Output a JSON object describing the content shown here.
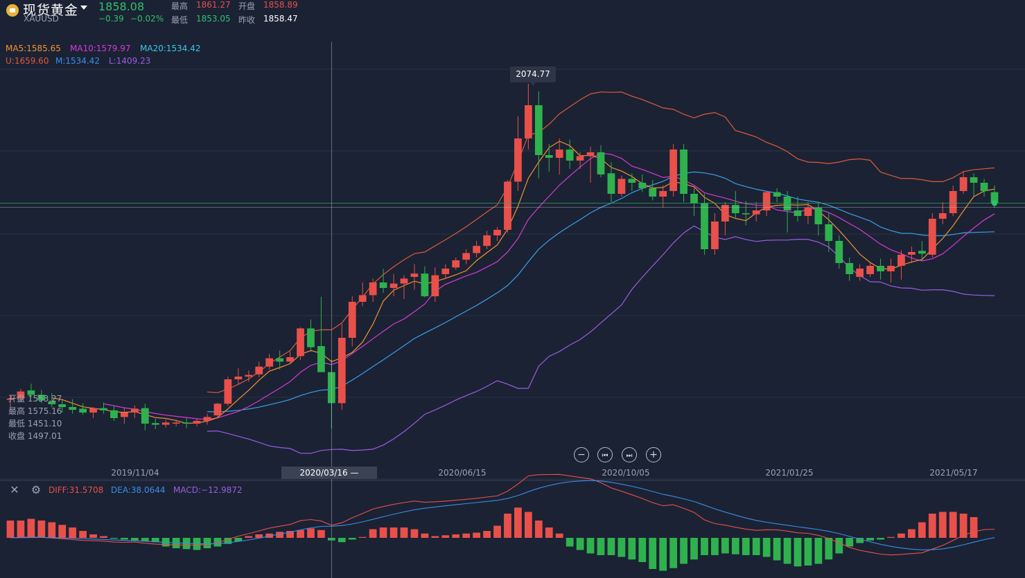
{
  "header": {
    "title": "现货黄金",
    "symbol": "XAUUSD",
    "last_price": "1858.08",
    "change": "−0.39",
    "change_pct": "−0.02%",
    "high_label": "最高",
    "high": "1861.27",
    "open_label": "开盘",
    "open": "1858.89",
    "low_label": "最低",
    "low": "1853.05",
    "prev_label": "昨收",
    "prev": "1858.47"
  },
  "indicators": {
    "ma5": "MA5:1585.65",
    "ma10": "MA10:1579.97",
    "ma20": "MA20:1534.42",
    "boll_u": "U:1659.60",
    "boll_m": "M:1534.42",
    "boll_l": "L:1409.23"
  },
  "crosshair": {
    "date": "2020/03/16 —",
    "open": "开盘 1553.27",
    "high": "最高 1575.16",
    "low": "最低 1451.10",
    "close": "收盘 1497.01"
  },
  "tooltip_high": "2074.77",
  "x_ticks": [
    "2019/11/04",
    "2020/06/15",
    "2020/10/05",
    "2021/01/25",
    "2021/05/17"
  ],
  "macd": {
    "diff": "DIFF:31.5708",
    "dea": "DEA:38.0644",
    "macd": "MACD:−12.9872"
  },
  "colors": {
    "background": "#1b2234",
    "up": "#e9504a",
    "down": "#2fb24d",
    "ma5": "#f5922f",
    "ma10": "#d63bd6",
    "ma20": "#3aa0e8",
    "boll_u": "#e05a3a",
    "boll_l": "#9b5de5"
  },
  "icons": {
    "close": "close-icon",
    "settings": "settings-icon",
    "zoom_out": "minus-icon",
    "zoom_in": "plus-icon",
    "prev": "skip-back-icon",
    "next": "skip-forward-icon"
  },
  "chart_data": {
    "type": "candlestick",
    "title": "现货黄金 XAUUSD",
    "period": "weekly",
    "y_range": [
      1400,
      2100
    ],
    "last_close": 1858.08,
    "candles": [
      [
        1503,
        1512,
        1490,
        1505
      ],
      [
        1505,
        1523,
        1500,
        1518
      ],
      [
        1520,
        1532,
        1508,
        1512
      ],
      [
        1512,
        1521,
        1497,
        1502
      ],
      [
        1500,
        1515,
        1490,
        1495
      ],
      [
        1495,
        1503,
        1480,
        1490
      ],
      [
        1490,
        1504,
        1478,
        1485
      ],
      [
        1487,
        1497,
        1476,
        1480
      ],
      [
        1480,
        1490,
        1470,
        1488
      ],
      [
        1488,
        1498,
        1478,
        1484
      ],
      [
        1484,
        1491,
        1465,
        1470
      ],
      [
        1472,
        1488,
        1460,
        1480
      ],
      [
        1480,
        1493,
        1470,
        1487
      ],
      [
        1488,
        1496,
        1448,
        1460
      ],
      [
        1461,
        1469,
        1450,
        1458
      ],
      [
        1458,
        1467,
        1453,
        1462
      ],
      [
        1460,
        1467,
        1455,
        1462
      ],
      [
        1462,
        1470,
        1452,
        1460
      ],
      [
        1460,
        1470,
        1455,
        1465
      ],
      [
        1465,
        1478,
        1458,
        1472
      ],
      [
        1475,
        1498,
        1470,
        1496
      ],
      [
        1496,
        1545,
        1492,
        1540
      ],
      [
        1540,
        1560,
        1532,
        1545
      ],
      [
        1545,
        1556,
        1536,
        1548
      ],
      [
        1549,
        1572,
        1544,
        1563
      ],
      [
        1563,
        1586,
        1558,
        1578
      ],
      [
        1578,
        1592,
        1558,
        1572
      ],
      [
        1572,
        1590,
        1568,
        1580
      ],
      [
        1582,
        1634,
        1575,
        1632
      ],
      [
        1632,
        1648,
        1590,
        1598
      ],
      [
        1600,
        1689,
        1565,
        1553
      ],
      [
        1553,
        1575,
        1451,
        1497
      ],
      [
        1497,
        1640,
        1485,
        1615
      ],
      [
        1615,
        1690,
        1600,
        1680
      ],
      [
        1680,
        1715,
        1672,
        1692
      ],
      [
        1692,
        1722,
        1680,
        1715
      ],
      [
        1715,
        1740,
        1696,
        1705
      ],
      [
        1705,
        1730,
        1690,
        1713
      ],
      [
        1713,
        1728,
        1685,
        1722
      ],
      [
        1725,
        1748,
        1702,
        1731
      ],
      [
        1731,
        1744,
        1688,
        1690
      ],
      [
        1690,
        1742,
        1680,
        1728
      ],
      [
        1730,
        1748,
        1722,
        1740
      ],
      [
        1742,
        1760,
        1738,
        1755
      ],
      [
        1756,
        1775,
        1748,
        1768
      ],
      [
        1768,
        1790,
        1760,
        1781
      ],
      [
        1781,
        1808,
        1775,
        1800
      ],
      [
        1800,
        1815,
        1790,
        1810
      ],
      [
        1810,
        1900,
        1805,
        1897
      ],
      [
        1897,
        2015,
        1880,
        1975
      ],
      [
        1975,
        2074,
        1955,
        2035
      ],
      [
        2035,
        2060,
        1903,
        1945
      ],
      [
        1945,
        1965,
        1915,
        1940
      ],
      [
        1940,
        1975,
        1910,
        1955
      ],
      [
        1955,
        1973,
        1920,
        1935
      ],
      [
        1935,
        1950,
        1920,
        1943
      ],
      [
        1943,
        1960,
        1895,
        1950
      ],
      [
        1950,
        1963,
        1905,
        1910
      ],
      [
        1912,
        1932,
        1860,
        1875
      ],
      [
        1875,
        1908,
        1870,
        1902
      ],
      [
        1902,
        1912,
        1880,
        1895
      ],
      [
        1895,
        1910,
        1878,
        1885
      ],
      [
        1885,
        1900,
        1863,
        1870
      ],
      [
        1870,
        1890,
        1850,
        1880
      ],
      [
        1880,
        1965,
        1870,
        1955
      ],
      [
        1955,
        1965,
        1860,
        1875
      ],
      [
        1875,
        1885,
        1835,
        1858
      ],
      [
        1858,
        1875,
        1765,
        1775
      ],
      [
        1775,
        1840,
        1765,
        1825
      ],
      [
        1825,
        1860,
        1800,
        1855
      ],
      [
        1855,
        1880,
        1830,
        1840
      ],
      [
        1840,
        1862,
        1818,
        1838
      ],
      [
        1838,
        1860,
        1825,
        1845
      ],
      [
        1845,
        1880,
        1835,
        1878
      ],
      [
        1878,
        1885,
        1860,
        1870
      ],
      [
        1870,
        1880,
        1805,
        1845
      ],
      [
        1845,
        1870,
        1825,
        1835
      ],
      [
        1835,
        1860,
        1820,
        1850
      ],
      [
        1850,
        1860,
        1800,
        1820
      ],
      [
        1820,
        1840,
        1770,
        1790
      ],
      [
        1790,
        1800,
        1740,
        1750
      ],
      [
        1750,
        1760,
        1718,
        1730
      ],
      [
        1725,
        1748,
        1718,
        1740
      ],
      [
        1730,
        1750,
        1725,
        1745
      ],
      [
        1745,
        1758,
        1720,
        1735
      ],
      [
        1735,
        1758,
        1715,
        1745
      ],
      [
        1745,
        1773,
        1720,
        1765
      ],
      [
        1765,
        1780,
        1750,
        1770
      ],
      [
        1772,
        1790,
        1755,
        1767
      ],
      [
        1765,
        1840,
        1760,
        1830
      ],
      [
        1830,
        1860,
        1820,
        1840
      ],
      [
        1840,
        1890,
        1835,
        1880
      ],
      [
        1880,
        1915,
        1875,
        1905
      ],
      [
        1905,
        1912,
        1870,
        1895
      ],
      [
        1895,
        1902,
        1870,
        1880
      ],
      [
        1878,
        1890,
        1850,
        1858
      ]
    ],
    "macd_hist": [
      20,
      20,
      22,
      20,
      18,
      15,
      12,
      8,
      4,
      2,
      -1,
      -2,
      -3,
      -4,
      -5,
      -10,
      -12,
      -13,
      -14,
      -12,
      -10,
      -7,
      -4,
      2,
      4,
      5,
      7,
      8,
      9,
      11,
      9,
      -3,
      -5,
      -2,
      1,
      10,
      12,
      12,
      12,
      10,
      5,
      2,
      3,
      4,
      5,
      6,
      8,
      14,
      28,
      35,
      30,
      20,
      12,
      5,
      -10,
      -14,
      -18,
      -20,
      -20,
      -22,
      -25,
      -28,
      -36,
      -38,
      -35,
      -30,
      -25,
      -20,
      -20,
      -18,
      -19,
      -20,
      -20,
      -22,
      -26,
      -30,
      -33,
      -32,
      -30,
      -25,
      -18,
      -10,
      -6,
      -3,
      -2,
      1,
      5,
      10,
      18,
      28,
      30,
      30,
      28,
      24
    ]
  }
}
